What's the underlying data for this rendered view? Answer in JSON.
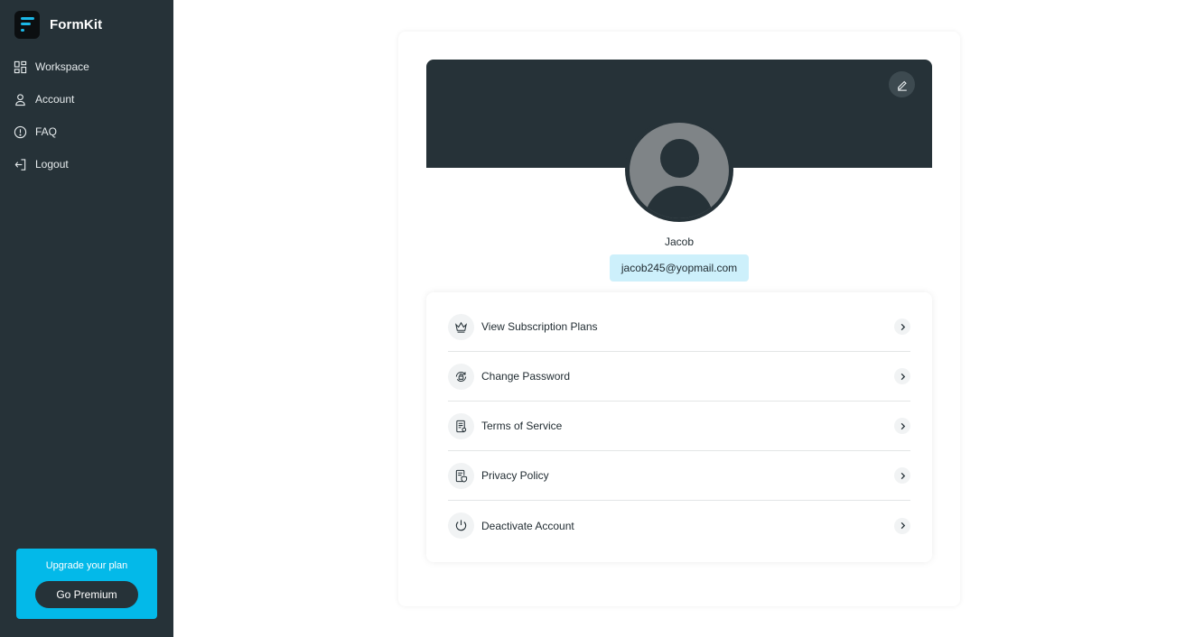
{
  "app": {
    "name": "FormKit"
  },
  "sidebar": {
    "items": [
      {
        "label": "Workspace",
        "icon": "grid-icon"
      },
      {
        "label": "Account",
        "icon": "user-icon"
      },
      {
        "label": "FAQ",
        "icon": "help-circle-icon"
      },
      {
        "label": "Logout",
        "icon": "logout-icon"
      }
    ],
    "upgrade": {
      "text": "Upgrade your plan",
      "button": "Go Premium"
    }
  },
  "profile": {
    "name": "Jacob",
    "email": "jacob245@yopmail.com"
  },
  "menu": {
    "items": [
      {
        "label": "View Subscription Plans",
        "icon": "crown-icon"
      },
      {
        "label": "Change Password",
        "icon": "lock-reset-icon"
      },
      {
        "label": "Terms of Service",
        "icon": "document-icon"
      },
      {
        "label": "Privacy Policy",
        "icon": "shield-document-icon"
      },
      {
        "label": "Deactivate Account",
        "icon": "power-icon"
      }
    ]
  },
  "colors": {
    "sidebar_bg": "#263238",
    "accent": "#03b9e9",
    "email_bg": "#cdf0fb",
    "avatar_gray": "#7f8487"
  }
}
